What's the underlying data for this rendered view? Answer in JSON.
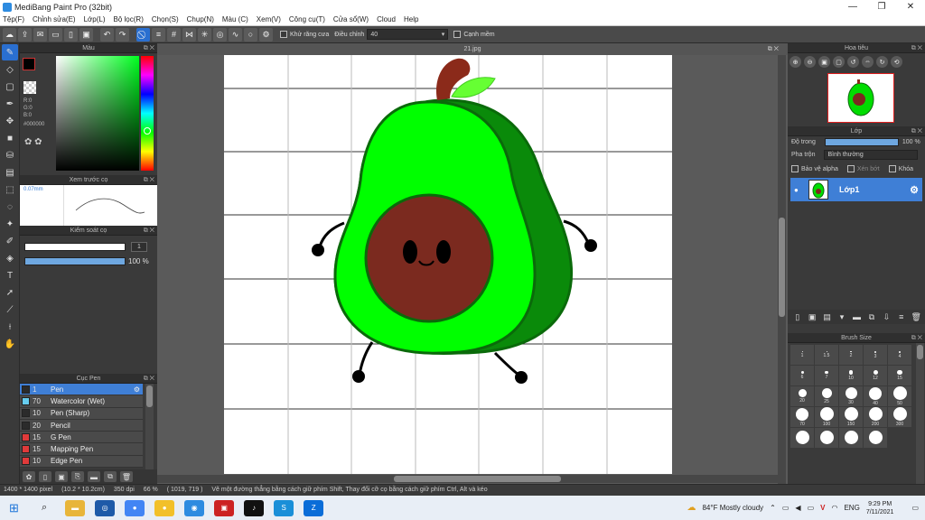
{
  "window": {
    "title": "MediBang Paint Pro (32bit)",
    "controls": [
      "—",
      "❐",
      "✕"
    ]
  },
  "menu": [
    "Tệp(F)",
    "Chỉnh sửa(E)",
    "Lớp(L)",
    "Bộ lọc(R)",
    "Chọn(S)",
    "Chụp(N)",
    "Màu (C)",
    "Xem(V)",
    "Công cụ(T)",
    "Cửa sổ(W)",
    "Cloud",
    "Help"
  ],
  "toolbar": {
    "antialias_label": "Khử răng cưa",
    "correction_label": "Điều chỉnh",
    "correction_value": "40",
    "soft_edge_label": "Cạnh mềm"
  },
  "color_panel": {
    "title": "Màu",
    "r": "R:0",
    "g": "G:0",
    "b": "B:0",
    "hex": "#000000",
    "fg_color": "#000000",
    "bg_color": "#ffffff"
  },
  "brush_preview": {
    "title": "Xem trước cọ",
    "size_text": "0.07mm"
  },
  "brush_control": {
    "title": "Kiểm soát cọ",
    "size_value": "1",
    "opacity_value": "100 %"
  },
  "brush_list": {
    "title": "Cục Pen",
    "items": [
      {
        "size": "1",
        "name": "Pen",
        "color": "#2b2b2b",
        "active": true
      },
      {
        "size": "70",
        "name": "Watercolor (Wet)",
        "color": "#66ccee",
        "active": false
      },
      {
        "size": "10",
        "name": "Pen (Sharp)",
        "color": "#2b2b2b",
        "active": false
      },
      {
        "size": "20",
        "name": "Pencil",
        "color": "#2b2b2b",
        "active": false
      },
      {
        "size": "15",
        "name": "G Pen",
        "color": "#e03a3a",
        "active": false
      },
      {
        "size": "15",
        "name": "Mapping Pen",
        "color": "#e03a3a",
        "active": false
      },
      {
        "size": "10",
        "name": "Edge Pen",
        "color": "#e03a3a",
        "active": false
      }
    ]
  },
  "canvas": {
    "tab_title": "21.jpg"
  },
  "navigator": {
    "title": "Hoa tiêu"
  },
  "layer_panel": {
    "title": "Lớp",
    "opacity_label": "Độ trong",
    "opacity_value": "100 %",
    "blend_label": "Pha trộn",
    "blend_value": "Bình thường",
    "protect_alpha": "Bảo vệ alpha",
    "clipping": "Xén bớt",
    "lock": "Khóa",
    "layer_name": "Lớp1"
  },
  "brush_size": {
    "title": "Brush Size",
    "cells": [
      {
        "label": "1",
        "d": 1
      },
      {
        "label": "1.5",
        "d": 1
      },
      {
        "label": "2",
        "d": 1.5
      },
      {
        "label": "3",
        "d": 2
      },
      {
        "label": "4",
        "d": 2
      },
      {
        "label": "6",
        "d": 3
      },
      {
        "label": "7",
        "d": 3.5
      },
      {
        "label": "10",
        "d": 4.5
      },
      {
        "label": "12",
        "d": 5
      },
      {
        "label": "15",
        "d": 5.5
      },
      {
        "label": "20",
        "d": 9
      },
      {
        "label": "25",
        "d": 11
      },
      {
        "label": "30",
        "d": 13
      },
      {
        "label": "40",
        "d": 14
      },
      {
        "label": "50",
        "d": 15
      },
      {
        "label": "70",
        "d": 14
      },
      {
        "label": "100",
        "d": 15
      },
      {
        "label": "150",
        "d": 15
      },
      {
        "label": "200",
        "d": 15
      },
      {
        "label": "300",
        "d": 15
      },
      {
        "label": "",
        "d": 15
      },
      {
        "label": "",
        "d": 15
      },
      {
        "label": "",
        "d": 15
      },
      {
        "label": "",
        "d": 15
      }
    ]
  },
  "status": {
    "pixels": "1400 * 1400 pixel",
    "cm": "(10.2 * 10.2cm)",
    "dpi": "350 dpi",
    "zoom": "66 %",
    "coords": "( 1019, 719 )",
    "hint": "Vẽ một đường thẳng bằng cách giữ phím Shift, Thay đổi cỡ cọ bằng cách giữ phím Ctrl, Alt và kéo"
  },
  "taskbar": {
    "weather": "84°F  Mostly cloudy",
    "lang": "ENG",
    "time": "9:29 PM",
    "date": "7/11/2021"
  },
  "colors": {
    "accent": "#2a6fd0",
    "avocado_light": "#00ff00",
    "avocado_dark": "#0a8a0a",
    "seed": "#7b2a1f",
    "stem": "#8b2a1a"
  }
}
